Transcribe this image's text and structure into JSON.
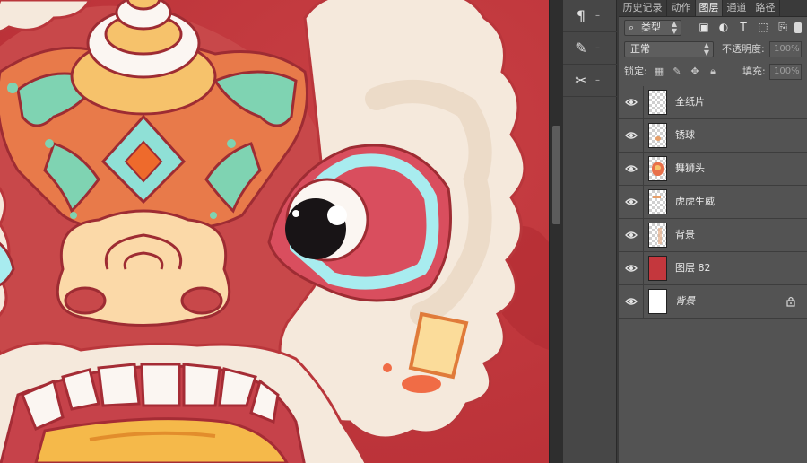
{
  "tabs": [
    {
      "label": "历史记录",
      "active": false
    },
    {
      "label": "动作",
      "active": false
    },
    {
      "label": "图层",
      "active": true
    },
    {
      "label": "通道",
      "active": false
    },
    {
      "label": "路径",
      "active": false
    }
  ],
  "filter": {
    "kind_label": "类型"
  },
  "blend": {
    "mode": "正常",
    "opacity_label": "不透明度:",
    "opacity_value": "100%"
  },
  "lock": {
    "label": "锁定:",
    "fill_label": "填充:",
    "fill_value": "100%"
  },
  "tools": [
    {
      "icon": "paragraph-icon",
      "glyph": "¶",
      "dash": "–"
    },
    {
      "icon": "brush-presets-icon",
      "glyph": "✎",
      "dash": "–"
    },
    {
      "icon": "tool-presets-icon",
      "glyph": "✂",
      "dash": "–"
    }
  ],
  "layers": [
    {
      "name": "全纸片",
      "visible": true,
      "thumb": "transparent",
      "locked": false,
      "italic": false
    },
    {
      "name": "锈球",
      "visible": true,
      "thumb": "transparent",
      "locked": false,
      "italic": false
    },
    {
      "name": "舞狮头",
      "visible": true,
      "thumb": "lion",
      "locked": false,
      "italic": false
    },
    {
      "name": "虎虎生威",
      "visible": true,
      "thumb": "transparent",
      "locked": false,
      "italic": false
    },
    {
      "name": "背景",
      "visible": true,
      "thumb": "transparent",
      "locked": false,
      "italic": false
    },
    {
      "name": "图层 82",
      "visible": true,
      "thumb": "red",
      "locked": false,
      "italic": false
    },
    {
      "name": "背景",
      "visible": true,
      "thumb": "white",
      "locked": true,
      "italic": true
    }
  ],
  "colors": {
    "canvas_red": "#c43a3c",
    "fur_cream": "#f5e9dc",
    "eye_red": "#d94e5e",
    "eye_cyan": "#a8ecef",
    "teal": "#7fd3b2",
    "gold": "#f6c26b",
    "panel_bg": "#535353"
  }
}
